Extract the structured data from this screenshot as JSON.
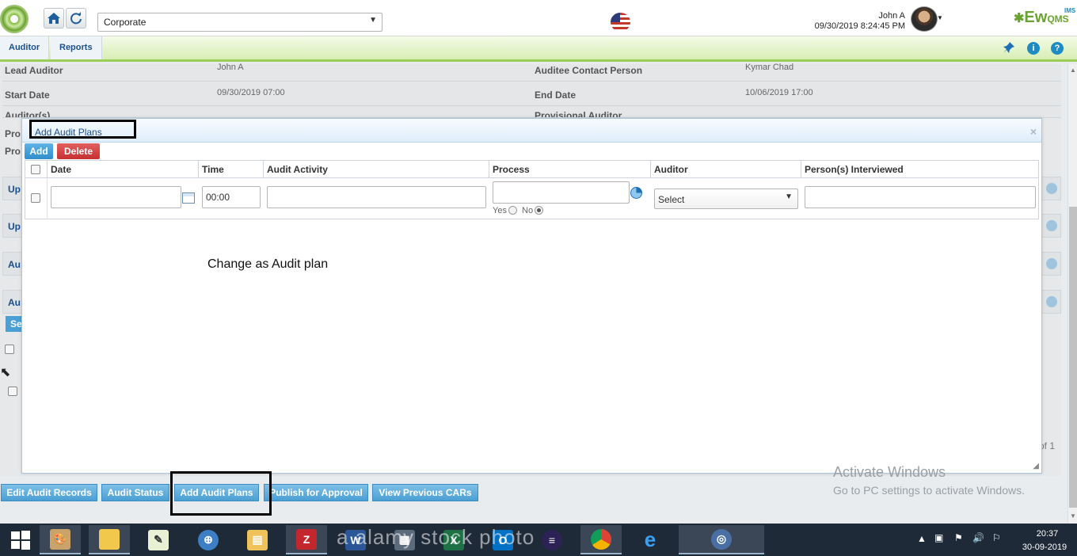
{
  "header": {
    "org_select": "Corporate",
    "user_name": "John A",
    "user_datetime": "09/30/2019 8:24:45 PM",
    "brand": "Ew",
    "brand_qms": "QMS",
    "brand_ims": "IMS"
  },
  "nav": {
    "tabs": [
      "Auditor",
      "Reports"
    ]
  },
  "background": {
    "lead_auditor_label": "Lead Auditor",
    "lead_auditor_value": "John A",
    "contact_label": "Auditee Contact Person",
    "contact_value": "Kymar Chad",
    "start_date_label": "Start Date",
    "start_date_value": "09/30/2019 07:00",
    "end_date_label": "End Date",
    "end_date_value": "10/06/2019 17:00",
    "auditors_label": "Auditor(s)",
    "provisional_label": "Provisional Auditor",
    "partial_1": "Pro",
    "partial_2": "Pro",
    "section_1": "Up",
    "section_2": "Up",
    "section_3": "Au",
    "section_4": "Au",
    "search_btn": "Se",
    "page_text": "of 1"
  },
  "dialog": {
    "title": "Add Audit Plans",
    "add_button": "Add",
    "delete_button": "Delete",
    "columns": [
      "Date",
      "Time",
      "Audit Activity",
      "Process",
      "Auditor",
      "Person(s) Interviewed"
    ],
    "row": {
      "date": "",
      "time": "00:00",
      "activity": "",
      "process": "",
      "radio_yes": "Yes",
      "radio_no": "No",
      "auditor": "Select",
      "interviewed": ""
    },
    "annotation": "Change as Audit plan"
  },
  "actions": [
    "Edit Audit Records",
    "Audit Status",
    "Add Audit Plans",
    "Publish for Approval",
    "View Previous CARs"
  ],
  "watermark": {
    "line1": "Activate Windows",
    "line2": "Go to PC settings to activate Windows."
  },
  "stock_watermark": "a alamy stock photo",
  "taskbar": {
    "time": "20:37",
    "date": "30-09-2019",
    "items": [
      "windows-start",
      "paint",
      "explorer-folder",
      "notepad",
      "safari",
      "file-manager",
      "filezilla",
      "word",
      "calculator",
      "excel",
      "outlook",
      "eclipse",
      "chrome",
      "internet-explorer",
      "remote-app"
    ]
  },
  "colors": {
    "nav_green": "#9ccd57",
    "button_blue": "#4a9fd4",
    "delete_red": "#c53030",
    "taskbar": "#1f2a38"
  }
}
